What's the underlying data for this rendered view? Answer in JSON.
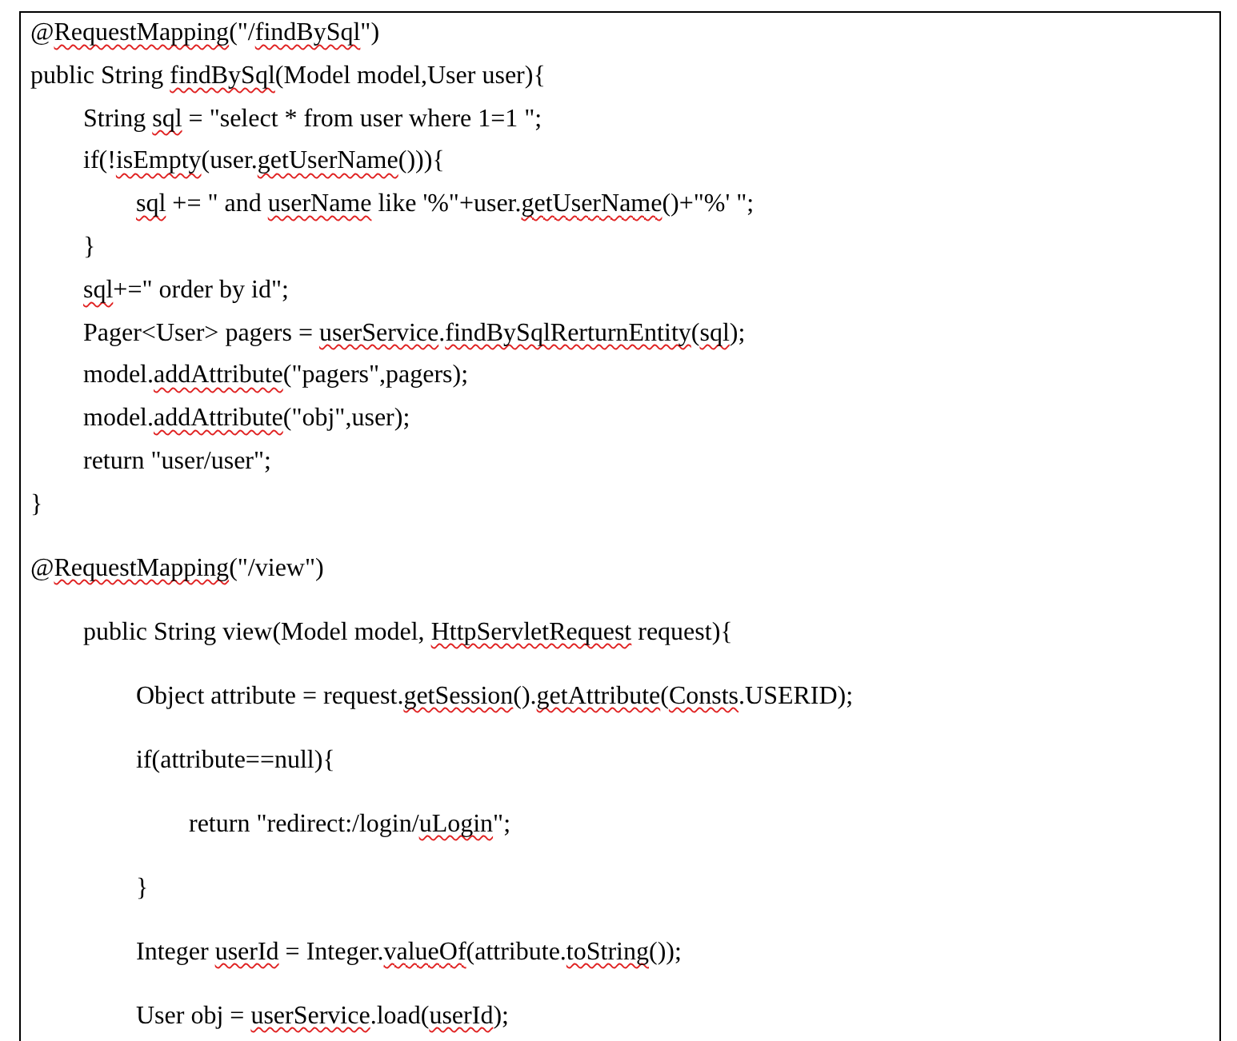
{
  "document": {
    "blocks": [
      {
        "kind": "compact",
        "lines": [
          {
            "parts": [
              {
                "text": "@",
                "misspelled": false
              },
              {
                "text": "RequestMapping",
                "misspelled": true
              },
              {
                "text": "(\"/",
                "misspelled": false
              },
              {
                "text": "findBySql",
                "misspelled": true
              },
              {
                "text": "\")",
                "misspelled": false
              }
            ]
          },
          {
            "parts": [
              {
                "text": "public String ",
                "misspelled": false
              },
              {
                "text": "findBySql",
                "misspelled": true
              },
              {
                "text": "(Model model,User user){",
                "misspelled": false
              }
            ],
            "children": [
              {
                "parts": [
                  {
                    "text": "String ",
                    "misspelled": false
                  },
                  {
                    "text": "sql",
                    "misspelled": true
                  },
                  {
                    "text": " = \"select * from user where 1=1 \";",
                    "misspelled": false
                  }
                ]
              },
              {
                "parts": [
                  {
                    "text": "if(!",
                    "misspelled": false
                  },
                  {
                    "text": "isEmpty",
                    "misspelled": true
                  },
                  {
                    "text": "(user.",
                    "misspelled": false
                  },
                  {
                    "text": "getUserName",
                    "misspelled": true
                  },
                  {
                    "text": "())){",
                    "misspelled": false
                  }
                ],
                "children": [
                  {
                    "parts": [
                      {
                        "text": "sql",
                        "misspelled": true
                      },
                      {
                        "text": " += \" and ",
                        "misspelled": false
                      },
                      {
                        "text": "userName",
                        "misspelled": true
                      },
                      {
                        "text": " like '%\"+user.",
                        "misspelled": false
                      },
                      {
                        "text": "getUserName",
                        "misspelled": true
                      },
                      {
                        "text": "()+\"%' \";",
                        "misspelled": false
                      }
                    ]
                  }
                ]
              },
              {
                "parts": [
                  {
                    "text": "}",
                    "misspelled": false
                  }
                ]
              },
              {
                "parts": [
                  {
                    "text": "sql",
                    "misspelled": true
                  },
                  {
                    "text": "+=\" order by id\";",
                    "misspelled": false
                  }
                ]
              },
              {
                "parts": [
                  {
                    "text": "Pager<User> pagers = ",
                    "misspelled": false
                  },
                  {
                    "text": "userService",
                    "misspelled": true
                  },
                  {
                    "text": ".",
                    "misspelled": false
                  },
                  {
                    "text": "findBySqlRerturnEntity",
                    "misspelled": true
                  },
                  {
                    "text": "(",
                    "misspelled": false
                  },
                  {
                    "text": "sql",
                    "misspelled": true
                  },
                  {
                    "text": ");",
                    "misspelled": false
                  }
                ]
              },
              {
                "parts": [
                  {
                    "text": "model.",
                    "misspelled": false
                  },
                  {
                    "text": "addAttribute",
                    "misspelled": true
                  },
                  {
                    "text": "(\"pagers\",pagers);",
                    "misspelled": false
                  }
                ]
              },
              {
                "parts": [
                  {
                    "text": "model.",
                    "misspelled": false
                  },
                  {
                    "text": "addAttribute",
                    "misspelled": true
                  },
                  {
                    "text": "(\"obj\",user);",
                    "misspelled": false
                  }
                ]
              },
              {
                "parts": [
                  {
                    "text": "return \"user/user\";",
                    "misspelled": false
                  }
                ]
              }
            ]
          },
          {
            "parts": [
              {
                "text": "}",
                "misspelled": false
              }
            ]
          }
        ]
      },
      {
        "kind": "spaced",
        "lines": [
          {
            "parts": [
              {
                "text": "@",
                "misspelled": false
              },
              {
                "text": "RequestMapping",
                "misspelled": true
              },
              {
                "text": "(\"/view\")",
                "misspelled": false
              }
            ],
            "children": [
              {
                "parts": [
                  {
                    "text": "public String view(Model model, ",
                    "misspelled": false
                  },
                  {
                    "text": "HttpServletRequest",
                    "misspelled": true
                  },
                  {
                    "text": " request){",
                    "misspelled": false
                  }
                ],
                "children": [
                  {
                    "parts": [
                      {
                        "text": "Object attribute = request.",
                        "misspelled": false
                      },
                      {
                        "text": "getSession",
                        "misspelled": true
                      },
                      {
                        "text": "().",
                        "misspelled": false
                      },
                      {
                        "text": "getAttribute",
                        "misspelled": true
                      },
                      {
                        "text": "(",
                        "misspelled": false
                      },
                      {
                        "text": "Consts",
                        "misspelled": true
                      },
                      {
                        "text": ".USERID);",
                        "misspelled": false
                      }
                    ]
                  },
                  {
                    "parts": [
                      {
                        "text": "if(attribute==null){",
                        "misspelled": false
                      }
                    ],
                    "children": [
                      {
                        "parts": [
                          {
                            "text": "return \"redirect:/login/",
                            "misspelled": false
                          },
                          {
                            "text": "uLogin",
                            "misspelled": true
                          },
                          {
                            "text": "\";",
                            "misspelled": false
                          }
                        ]
                      }
                    ]
                  },
                  {
                    "parts": [
                      {
                        "text": "}",
                        "misspelled": false
                      }
                    ]
                  },
                  {
                    "parts": [
                      {
                        "text": "Integer ",
                        "misspelled": false
                      },
                      {
                        "text": "userId",
                        "misspelled": true
                      },
                      {
                        "text": " = Integer.",
                        "misspelled": false
                      },
                      {
                        "text": "valueOf",
                        "misspelled": true
                      },
                      {
                        "text": "(attribute.",
                        "misspelled": false
                      },
                      {
                        "text": "toString",
                        "misspelled": true
                      },
                      {
                        "text": "());",
                        "misspelled": false
                      }
                    ]
                  },
                  {
                    "parts": [
                      {
                        "text": "User obj = ",
                        "misspelled": false
                      },
                      {
                        "text": "userService",
                        "misspelled": true
                      },
                      {
                        "text": ".load(",
                        "misspelled": false
                      },
                      {
                        "text": "userId",
                        "misspelled": true
                      },
                      {
                        "text": ");",
                        "misspelled": false
                      }
                    ]
                  }
                ]
              }
            ]
          }
        ]
      }
    ]
  }
}
